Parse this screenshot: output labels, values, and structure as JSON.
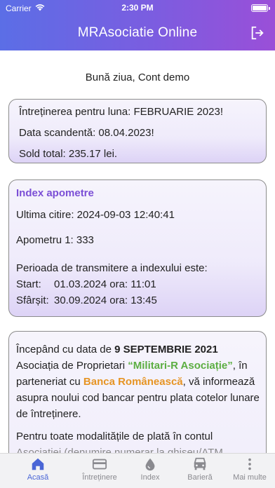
{
  "status_bar": {
    "carrier": "Carrier",
    "time": "2:30 PM"
  },
  "header": {
    "title": "MRAsociatie Online",
    "logout_icon": "logout-icon"
  },
  "greeting": "Bună ziua, Cont demo",
  "maintenance_card": {
    "title": "Întreținerea pentru luna: FEBRUARIE 2023!",
    "due_date": "Data scandentă: 08.04.2023!",
    "balance": "Sold total: 235.17 lei."
  },
  "water_index_card": {
    "title": "Index apometre",
    "last_reading": "Ultima citire: 2024-09-03 12:40:41",
    "meter_1": "Apometru 1: 333",
    "period_label": "Perioada de transmitere a indexului este:",
    "start_label": "Start:",
    "start_value": "01.03.2024 ora: 11:01",
    "end_label": "Sfârșit:",
    "end_value": "30.09.2024 ora: 13:45"
  },
  "announcement": {
    "p1_part1": "Începând cu data de ",
    "p1_date": "9 SEPTEMBRIE 2021",
    "p1_part2": " Asociația de Proprietari ",
    "p1_association": "“Militari-R Asociație”",
    "p1_part3": ", în parteneriat cu ",
    "p1_bank": "Banca Românească",
    "p1_part4": ", vă informează asupra noului cod bancar pentru plata cotelor lunare de întreținere.",
    "p2_visible": "Pentru toate modalitățile de plată în contul",
    "p2_cut": "Asociației (denumire numerar la ghișeu/ATM"
  },
  "colors": {
    "header_gradient_start": "#5b6ee6",
    "header_gradient_end": "#9a4fd8",
    "accent_purple": "#7b4fd6",
    "association_green": "#5cae42",
    "bank_orange": "#e69424",
    "tab_active": "#4a66d6"
  },
  "tabs": [
    {
      "label": "Acasă",
      "icon": "home-icon",
      "active": true
    },
    {
      "label": "Întreținere",
      "icon": "card-icon",
      "active": false
    },
    {
      "label": "Index",
      "icon": "water-drop-icon",
      "active": false
    },
    {
      "label": "Barieră",
      "icon": "car-icon",
      "active": false
    },
    {
      "label": "Mai multe",
      "icon": "more-vertical-icon",
      "active": false
    }
  ]
}
